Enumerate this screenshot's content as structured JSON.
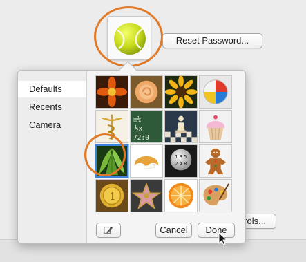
{
  "header": {
    "reset_password_label": "Reset Password...",
    "current_picture_icon": "tennis-ball-icon"
  },
  "background_controls": {
    "controls_button_label": "rols..."
  },
  "picker": {
    "sidebar_items": [
      {
        "label": "Defaults",
        "selected": true
      },
      {
        "label": "Recents",
        "selected": false
      },
      {
        "label": "Camera",
        "selected": false
      }
    ],
    "pictures": [
      {
        "icon": "red-flower-icon"
      },
      {
        "icon": "orange-rose-icon"
      },
      {
        "icon": "sunflower-icon"
      },
      {
        "icon": "beach-ball-icon"
      },
      {
        "icon": "caduceus-icon"
      },
      {
        "icon": "chalkboard-math-icon"
      },
      {
        "icon": "chess-pieces-icon"
      },
      {
        "icon": "cupcake-icon"
      },
      {
        "icon": "green-leaves-icon",
        "selected": true
      },
      {
        "icon": "fortune-cookie-icon"
      },
      {
        "icon": "gear-shift-icon"
      },
      {
        "icon": "gingerbread-man-icon"
      },
      {
        "icon": "gold-medal-icon"
      },
      {
        "icon": "walk-of-fame-star-icon"
      },
      {
        "icon": "orange-slice-icon"
      },
      {
        "icon": "paint-palette-icon"
      }
    ],
    "edit_icon": "pencil-edit-icon",
    "cancel_label": "Cancel",
    "done_label": "Done"
  },
  "colors": {
    "highlight_ring": "#e07a28",
    "selection_blue": "#3b82d9"
  }
}
